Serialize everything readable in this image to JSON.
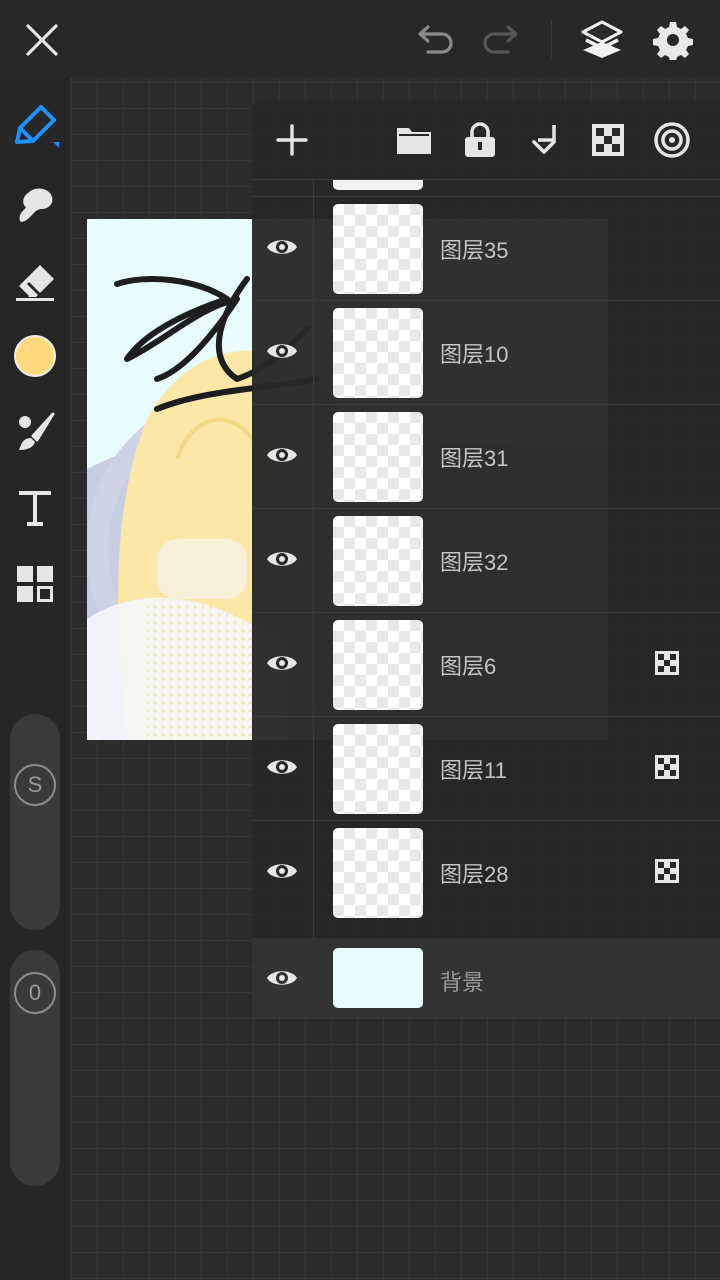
{
  "colors": {
    "accent": "#1e90ff",
    "current_color": "#ffd97a",
    "panel_bg": "#282828",
    "background_layer": "#e8fbfd"
  },
  "topbar": {
    "icons": [
      "close-icon",
      "undo-icon",
      "redo-icon",
      "layers-icon",
      "settings-icon"
    ]
  },
  "tools": {
    "icons": [
      "pen-icon",
      "smudge-icon",
      "eraser-icon",
      "color-swatch",
      "brush-icon",
      "text-icon",
      "grid-menu-icon"
    ],
    "size_slider_label": "S",
    "opacity_slider_label": "0"
  },
  "layers_panel": {
    "toolbar_icons": [
      "add-icon",
      "folder-icon",
      "lock-icon",
      "merge-down-icon",
      "checker-icon",
      "target-icon"
    ],
    "layers": [
      {
        "name": "图层35",
        "visible": true,
        "clipping": false
      },
      {
        "name": "图层10",
        "visible": true,
        "clipping": false
      },
      {
        "name": "图层31",
        "visible": true,
        "clipping": false
      },
      {
        "name": "图层32",
        "visible": true,
        "clipping": false
      },
      {
        "name": "图层6",
        "visible": true,
        "clipping": true
      },
      {
        "name": "图层11",
        "visible": true,
        "clipping": true
      },
      {
        "name": "图层28",
        "visible": true,
        "clipping": true
      }
    ],
    "background_layer": {
      "name": "背景",
      "visible": true
    }
  }
}
